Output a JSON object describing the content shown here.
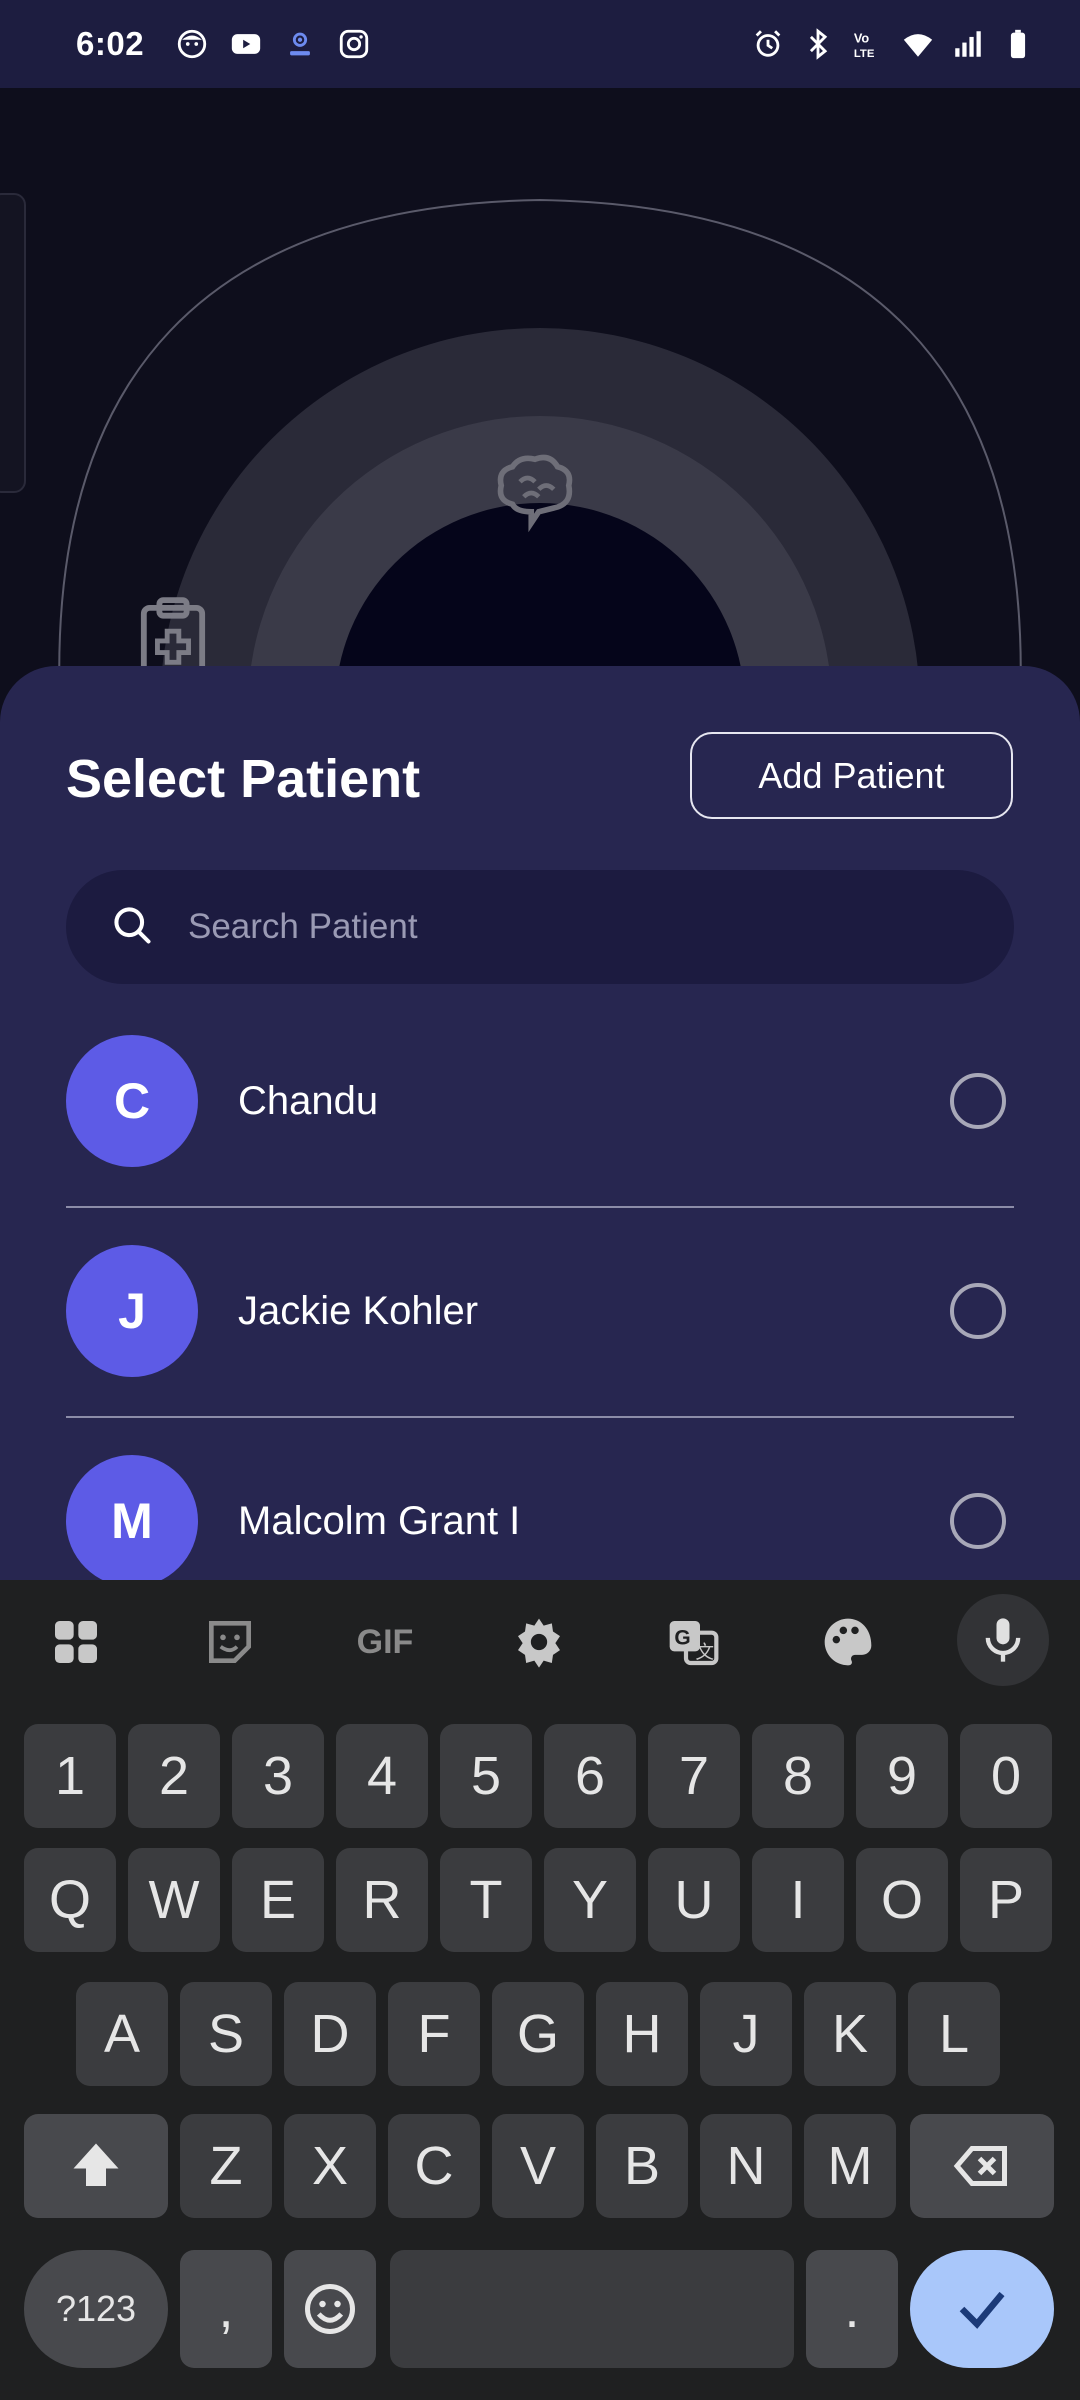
{
  "status_bar": {
    "time": "6:02",
    "left_icons": [
      "face-icon",
      "youtube-icon",
      "podcast-icon",
      "instagram-icon"
    ],
    "right_icons": [
      "alarm-icon",
      "bluetooth-icon",
      "volte-icon",
      "wifi-icon",
      "signal-icon",
      "battery-icon"
    ]
  },
  "sheet": {
    "title": "Select Patient",
    "add_button": "Add Patient",
    "search_placeholder": "Search Patient",
    "patients": [
      {
        "initial": "C",
        "name": "Chandu"
      },
      {
        "initial": "J",
        "name": "Jackie Kohler"
      },
      {
        "initial": "M",
        "name": "Malcolm Grant I"
      }
    ]
  },
  "keyboard": {
    "toolbar": [
      "apps-icon",
      "sticker-icon",
      "gif-icon",
      "settings-icon",
      "translate-icon",
      "palette-icon",
      "mic-icon"
    ],
    "gif_label": "GIF",
    "row_numbers": [
      "1",
      "2",
      "3",
      "4",
      "5",
      "6",
      "7",
      "8",
      "9",
      "0"
    ],
    "row_q": [
      "Q",
      "W",
      "E",
      "R",
      "T",
      "Y",
      "U",
      "I",
      "O",
      "P"
    ],
    "row_a": [
      "A",
      "S",
      "D",
      "F",
      "G",
      "H",
      "J",
      "K",
      "L"
    ],
    "row_z": [
      "Z",
      "X",
      "C",
      "V",
      "B",
      "N",
      "M"
    ],
    "symbols_label": "?123",
    "comma": ",",
    "period": "."
  },
  "colors": {
    "sheet_bg": "#272650",
    "avatar": "#5d5be6",
    "search_bg": "#1c1b40",
    "enter_key": "#a9c7fa"
  }
}
